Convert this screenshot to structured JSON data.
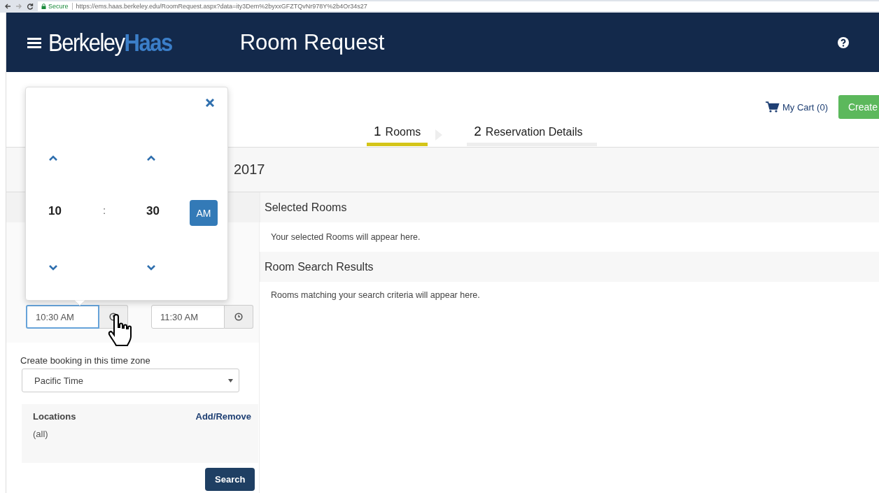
{
  "browser": {
    "secure_label": "Secure",
    "url": "https://ems.haas.berkeley.edu/RoomRequest.aspx?data=ity3Dem%2byxxGFZTQvNr978Y%2b4Or34s27"
  },
  "header": {
    "logo_primary": "Berkeley",
    "logo_accent": "Haas",
    "title": "Room Request"
  },
  "cart": {
    "label": "My Cart (0)"
  },
  "create_button": "Create",
  "steps": [
    {
      "number": "1",
      "label": "Rooms",
      "selected": true
    },
    {
      "number": "2",
      "label": "Reservation Details",
      "selected": false
    }
  ],
  "date_heading": "2017",
  "time_picker": {
    "hour": "10",
    "separator": ":",
    "minute": "30",
    "period": "AM"
  },
  "start_time": {
    "value": "10:30 AM",
    "focused": true
  },
  "end_time": {
    "value": "11:30 AM",
    "focused": false
  },
  "timezone": {
    "label": "Create booking in this time zone",
    "value": "Pacific Time"
  },
  "locations": {
    "label": "Locations",
    "action": "Add/Remove",
    "value": "(all)"
  },
  "search_button": "Search",
  "sections": [
    {
      "title": "Selected Rooms",
      "message": "Your selected Rooms will appear here."
    },
    {
      "title": "Room Search Results",
      "message": "Rooms matching your search criteria will appear here."
    }
  ]
}
